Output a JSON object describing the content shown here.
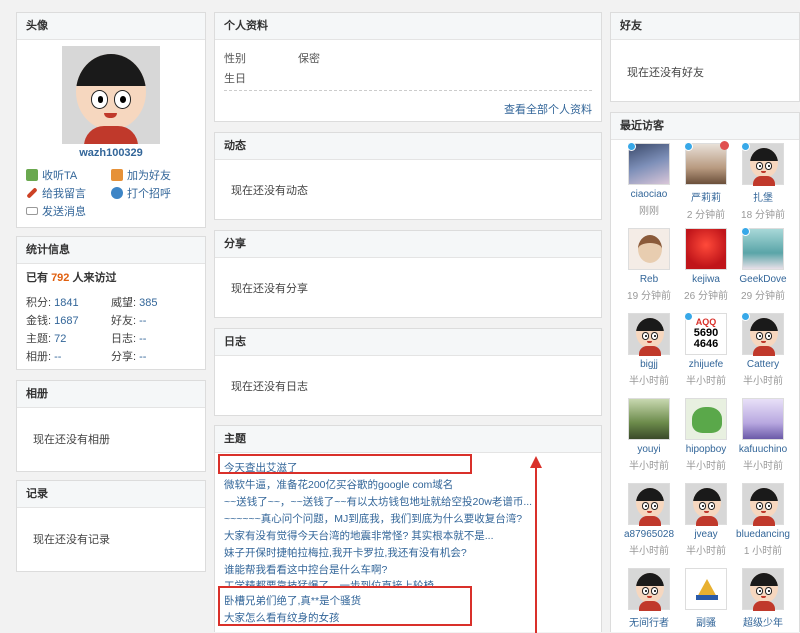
{
  "avatar_panel": {
    "title": "头像",
    "username": "wazh100329",
    "actions": [
      {
        "label": "收听TA",
        "icon": "listen-icon",
        "color": "#6aa84f"
      },
      {
        "label": "加为好友",
        "icon": "add-friend-icon",
        "color": "#e69138"
      },
      {
        "label": "给我留言",
        "icon": "pencil-icon",
        "color": "#cc4125"
      },
      {
        "label": "打个招呼",
        "icon": "greet-icon",
        "color": "#3d85c6"
      },
      {
        "label": "发送消息",
        "icon": "mail-icon",
        "color": "#999999"
      }
    ]
  },
  "stats_panel": {
    "title": "统计信息",
    "visit_prefix": "已有",
    "visit_count": "792",
    "visit_suffix": "人来访过",
    "items": [
      {
        "label": "积分:",
        "value": "1841"
      },
      {
        "label": "威望:",
        "value": "385"
      },
      {
        "label": "金钱:",
        "value": "1687"
      },
      {
        "label": "好友:",
        "value": "--"
      },
      {
        "label": "主题:",
        "value": "72"
      },
      {
        "label": "日志:",
        "value": "--"
      },
      {
        "label": "相册:",
        "value": "--"
      },
      {
        "label": "分享:",
        "value": "--"
      }
    ]
  },
  "album_panel": {
    "title": "相册",
    "empty": "现在还没有相册"
  },
  "record_panel": {
    "title": "记录",
    "empty": "现在还没有记录"
  },
  "profile_panel": {
    "title": "个人资料",
    "gender_label": "性别",
    "gender_value": "保密",
    "birthday_label": "生日",
    "more_link": "查看全部个人资料"
  },
  "feed_panel": {
    "title": "动态",
    "empty": "现在还没有动态"
  },
  "share_panel": {
    "title": "分享",
    "empty": "现在还没有分享"
  },
  "blog_panel": {
    "title": "日志",
    "empty": "现在还没有日志"
  },
  "topics_panel": {
    "title": "主题",
    "items": [
      "今天查出艾滋了",
      "微软牛逼，准备花200亿买谷歌的google com域名",
      "~~送钱了~~，~~送钱了~~有以太坊钱包地址就给空投20w老谱币...",
      "~~~~~~真心问个问题，MJ到底我，我们到底为什么要收复台湾?",
      "大家有没有觉得今天台湾的地震非常怪? 其实根本就不是...",
      "妹子开保时捷帕拉梅拉,我开卡罗拉,我还有没有机会?",
      "谁能帮我看看这中控台是什么车啊?",
      "工学精都要靠技猛爆了，一步到位直接上轮椅",
      "卧槽兄弟们绝了,真**是个骚货",
      "大家怎么看有纹身的女孩"
    ]
  },
  "friends_panel": {
    "title": "好友",
    "empty": "现在还没有好友"
  },
  "visitors_panel": {
    "title": "最近访客",
    "visitors": [
      {
        "name": "ciaociao",
        "time": "刚刚",
        "type": "anime"
      },
      {
        "name": "严莉莉",
        "time": "2 分钟前",
        "type": "anime2"
      },
      {
        "name": "扎堡",
        "time": "18 分钟前",
        "type": "default"
      },
      {
        "name": "Reb",
        "time": "19 分钟前",
        "type": "doll"
      },
      {
        "name": "kejiwa",
        "time": "26 分钟前",
        "type": "red"
      },
      {
        "name": "GeekDove",
        "time": "29 分钟前",
        "type": "anime3"
      },
      {
        "name": "bigjj",
        "time": "半小时前",
        "type": "default"
      },
      {
        "name": "zhijuefe",
        "time": "半小时前",
        "type": "captcha"
      },
      {
        "name": "Cattery",
        "time": "半小时前",
        "type": "default"
      },
      {
        "name": "youyi",
        "time": "半小时前",
        "type": "photo"
      },
      {
        "name": "hipopboy",
        "time": "半小时前",
        "type": "frog"
      },
      {
        "name": "kafuuchino",
        "time": "半小时前",
        "type": "anime4"
      },
      {
        "name": "a87965028",
        "time": "半小时前",
        "type": "default"
      },
      {
        "name": "jveay",
        "time": "半小时前",
        "type": "default"
      },
      {
        "name": "bluedancing",
        "time": "1 小时前",
        "type": "default"
      },
      {
        "name": "无间行者",
        "time": "",
        "type": "default"
      },
      {
        "name": "副骚",
        "time": "",
        "type": "logo"
      },
      {
        "name": "超级少年",
        "time": "",
        "type": "default"
      }
    ],
    "captcha_text": [
      "AQQ",
      "5690",
      "4646"
    ]
  },
  "colors": {
    "accent": "#336699",
    "highlight": "#d9302a",
    "visit_count": "#e06010"
  }
}
